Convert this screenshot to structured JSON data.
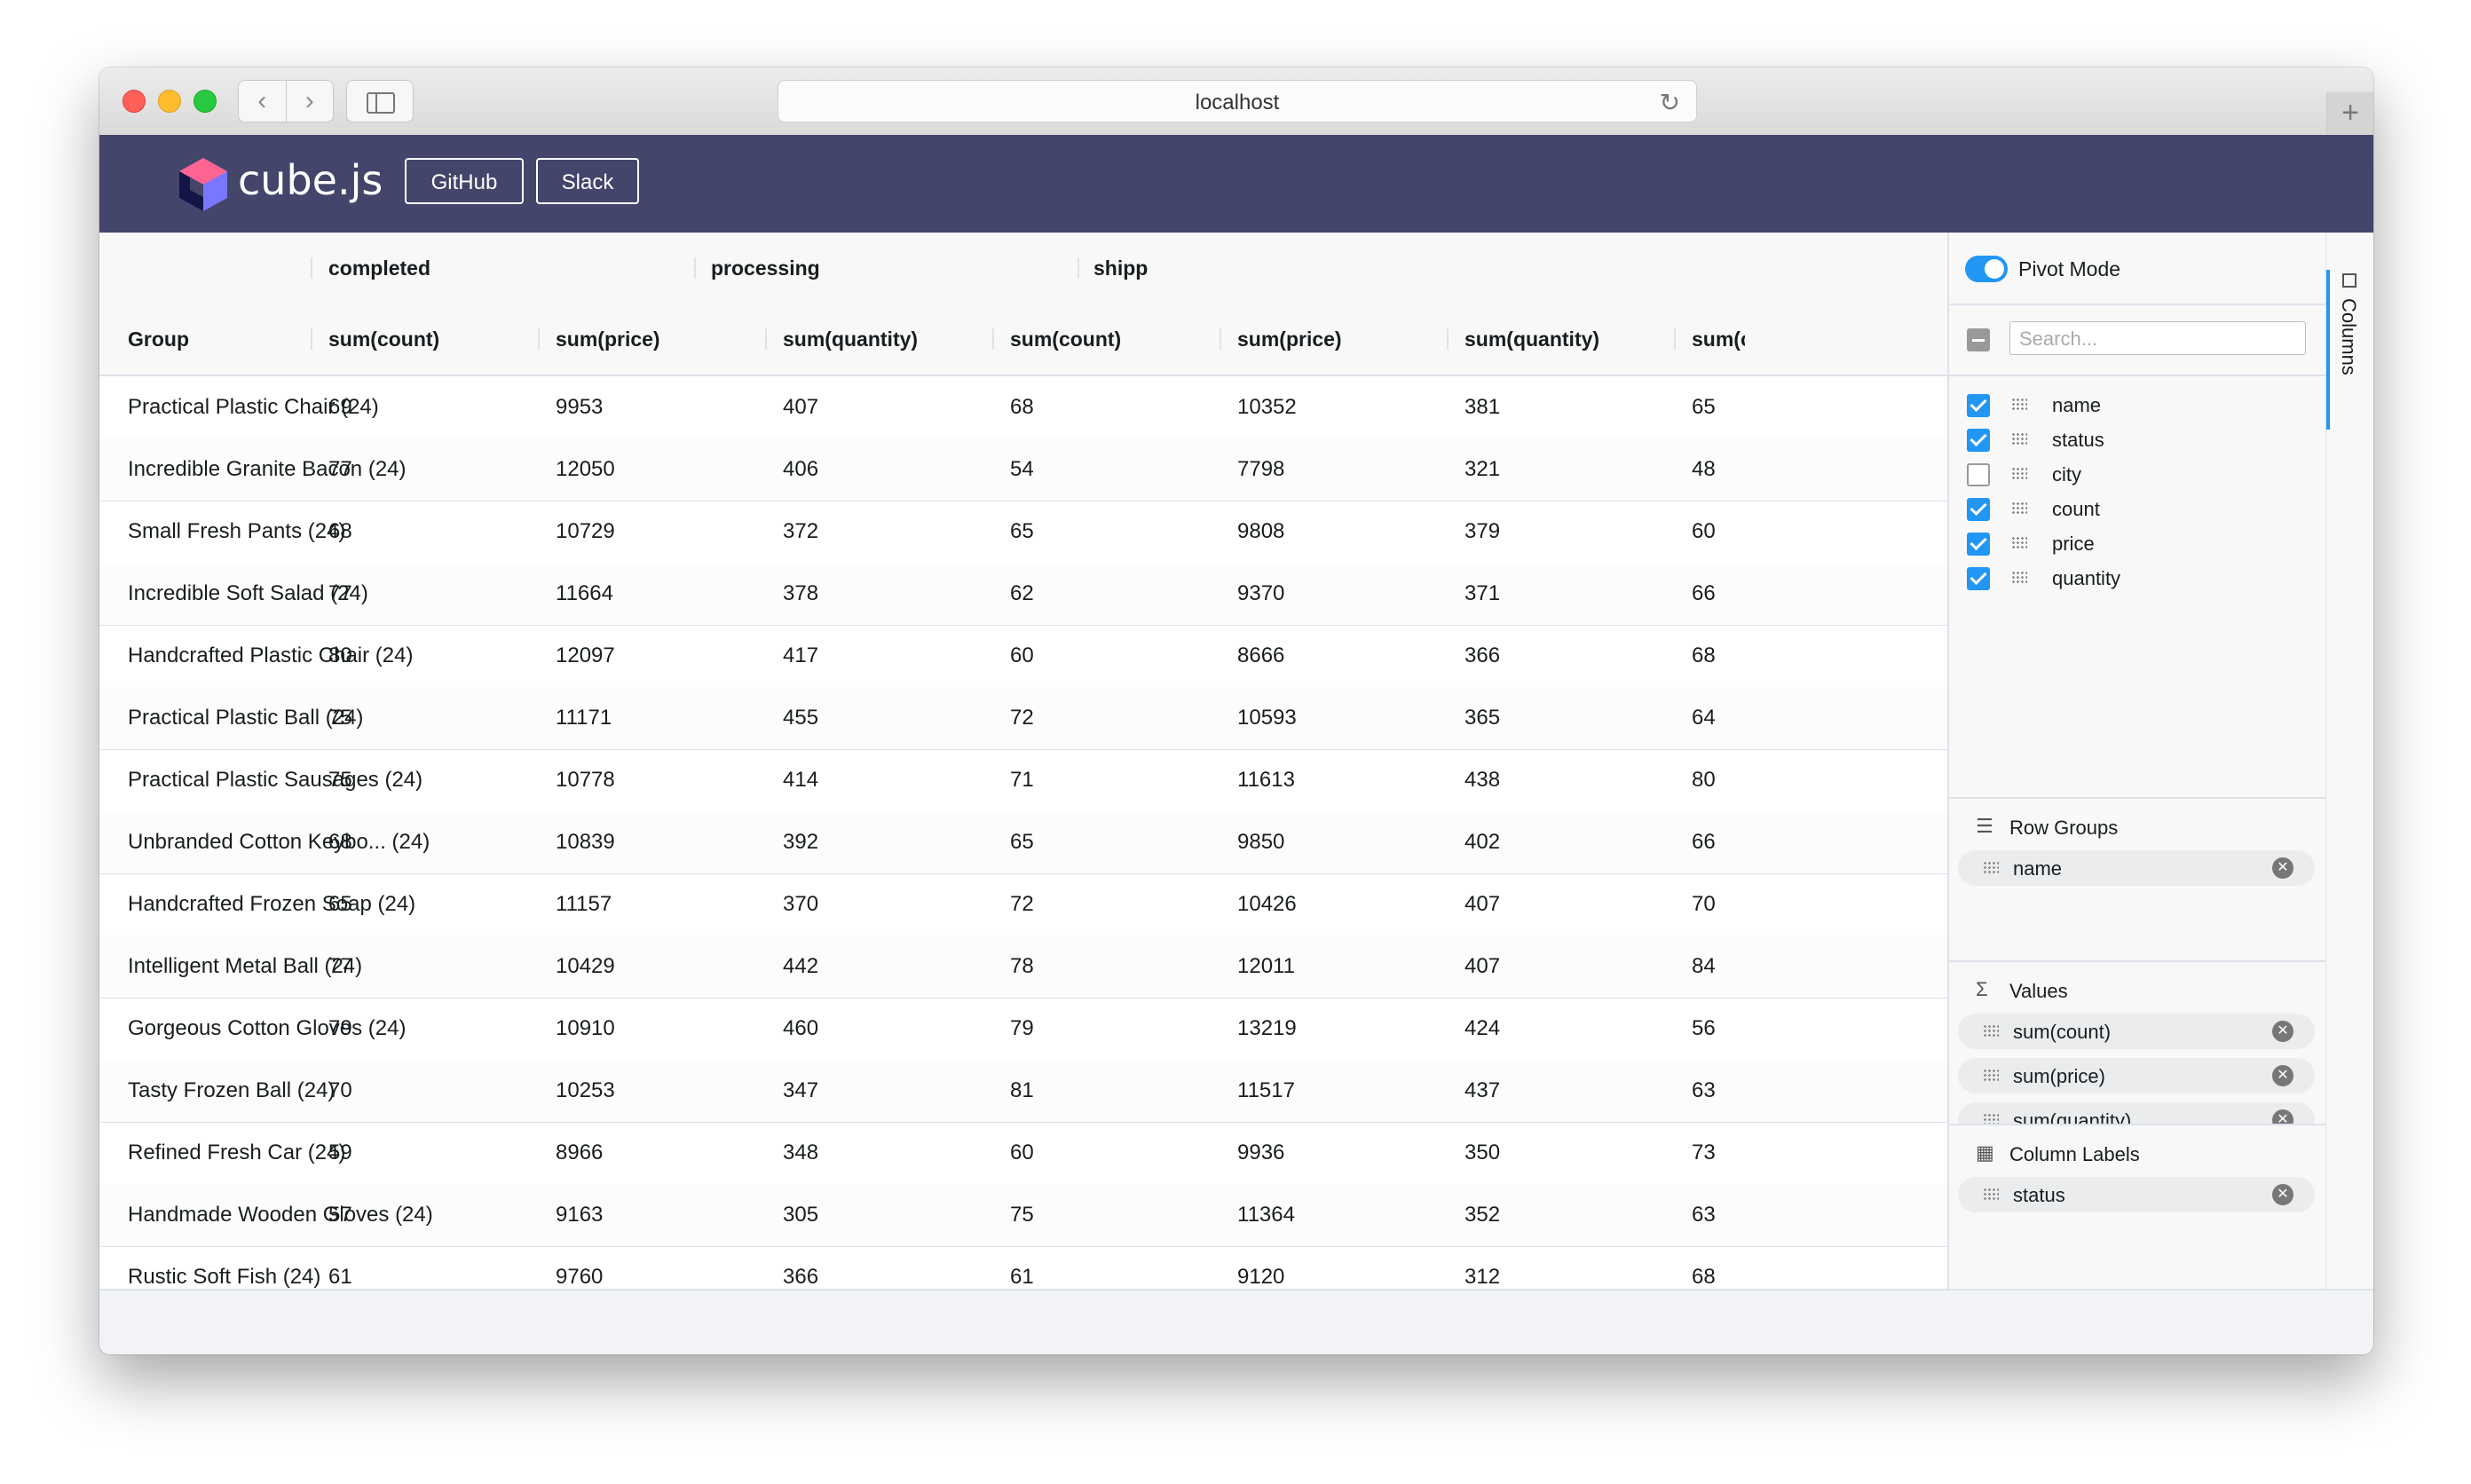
{
  "browser": {
    "url": "localhost"
  },
  "header": {
    "brand": "cube.js",
    "github_label": "GitHub",
    "slack_label": "Slack"
  },
  "grid": {
    "group_headers": [
      "completed",
      "processing",
      "shipped"
    ],
    "group_column_label": "Group",
    "value_headers": [
      "sum(count)",
      "sum(price)",
      "sum(quantity)",
      "sum(count)",
      "sum(price)",
      "sum(quantity)",
      "sum(cou"
    ],
    "rows": [
      {
        "group": "Practical Plastic Chair (24)",
        "values": [
          "69",
          "9953",
          "407",
          "68",
          "10352",
          "381",
          "65"
        ]
      },
      {
        "group": "Incredible Granite Bacon (24)",
        "values": [
          "77",
          "12050",
          "406",
          "54",
          "7798",
          "321",
          "48"
        ]
      },
      {
        "group": "Small Fresh Pants (24)",
        "values": [
          "68",
          "10729",
          "372",
          "65",
          "9808",
          "379",
          "60"
        ]
      },
      {
        "group": "Incredible Soft Salad (24)",
        "values": [
          "77",
          "11664",
          "378",
          "62",
          "9370",
          "371",
          "66"
        ]
      },
      {
        "group": "Handcrafted Plastic Chair (24)",
        "values": [
          "80",
          "12097",
          "417",
          "60",
          "8666",
          "366",
          "68"
        ]
      },
      {
        "group": "Practical Plastic Ball (24)",
        "values": [
          "75",
          "11171",
          "455",
          "72",
          "10593",
          "365",
          "64"
        ]
      },
      {
        "group": "Practical Plastic Sausages (24)",
        "values": [
          "75",
          "10778",
          "414",
          "71",
          "11613",
          "438",
          "80"
        ]
      },
      {
        "group": "Unbranded Cotton Keybo...  (24)",
        "values": [
          "68",
          "10839",
          "392",
          "65",
          "9850",
          "402",
          "66"
        ]
      },
      {
        "group": "Handcrafted Frozen Soap (24)",
        "values": [
          "65",
          "11157",
          "370",
          "72",
          "10426",
          "407",
          "70"
        ]
      },
      {
        "group": "Intelligent Metal Ball (24)",
        "values": [
          "77",
          "10429",
          "442",
          "78",
          "12011",
          "407",
          "84"
        ]
      },
      {
        "group": "Gorgeous Cotton Gloves (24)",
        "values": [
          "79",
          "10910",
          "460",
          "79",
          "13219",
          "424",
          "56"
        ]
      },
      {
        "group": "Tasty Frozen Ball (24)",
        "values": [
          "70",
          "10253",
          "347",
          "81",
          "11517",
          "437",
          "63"
        ]
      },
      {
        "group": "Refined Fresh Car (24)",
        "values": [
          "59",
          "8966",
          "348",
          "60",
          "9936",
          "350",
          "73"
        ]
      },
      {
        "group": "Handmade Wooden Gloves (24)",
        "values": [
          "57",
          "9163",
          "305",
          "75",
          "11364",
          "352",
          "63"
        ]
      },
      {
        "group": "Rustic Soft Fish (24)",
        "values": [
          "61",
          "9760",
          "366",
          "61",
          "9120",
          "312",
          "68"
        ]
      }
    ]
  },
  "sidebar": {
    "pivot_mode_label": "Pivot Mode",
    "search_placeholder": "Search...",
    "columns": [
      {
        "name": "name",
        "checked": true
      },
      {
        "name": "status",
        "checked": true
      },
      {
        "name": "city",
        "checked": false
      },
      {
        "name": "count",
        "checked": true
      },
      {
        "name": "price",
        "checked": true
      },
      {
        "name": "quantity",
        "checked": true
      }
    ],
    "row_groups": {
      "title": "Row Groups",
      "items": [
        "name"
      ]
    },
    "values": {
      "title": "Values",
      "items": [
        "sum(count)",
        "sum(price)",
        "sum(quantity)"
      ]
    },
    "column_labels": {
      "title": "Column Labels",
      "items": [
        "status"
      ]
    },
    "tab_label": "Columns"
  },
  "colors": {
    "header_bg": "#43456a",
    "accent": "#2196f3"
  }
}
